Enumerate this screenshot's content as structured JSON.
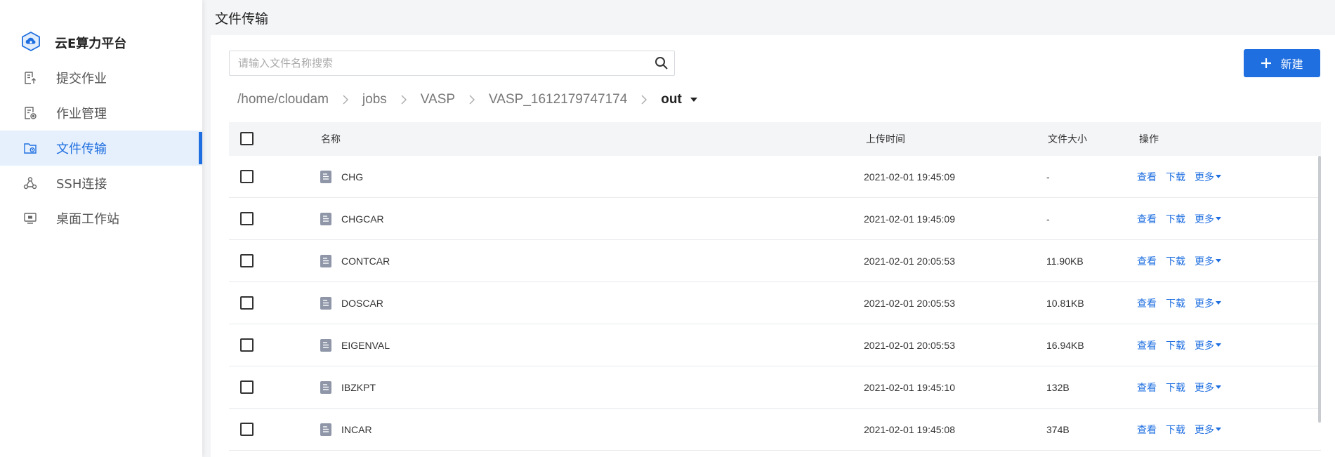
{
  "app": {
    "name": "云E算力平台",
    "page_title": "文件传输"
  },
  "sidebar": {
    "items": [
      {
        "label": "提交作业",
        "icon": "submit-job-icon"
      },
      {
        "label": "作业管理",
        "icon": "job-manage-icon"
      },
      {
        "label": "文件传输",
        "icon": "file-transfer-icon",
        "active": true
      },
      {
        "label": "SSH连接",
        "icon": "ssh-icon"
      },
      {
        "label": "桌面工作站",
        "icon": "desktop-icon"
      }
    ]
  },
  "search": {
    "placeholder": "请输入文件名称搜索",
    "value": ""
  },
  "toolbar": {
    "new_label": "新建"
  },
  "breadcrumb": {
    "items": [
      "/home/cloudam",
      "jobs",
      "VASP",
      "VASP_1612179747174"
    ],
    "current": "out"
  },
  "table": {
    "headers": {
      "name": "名称",
      "time": "上传时间",
      "size": "文件大小",
      "ops": "操作"
    },
    "ops_labels": {
      "view": "查看",
      "download": "下载",
      "more": "更多"
    },
    "rows": [
      {
        "name": "CHG",
        "time": "2021-02-01 19:45:09",
        "size": "-"
      },
      {
        "name": "CHGCAR",
        "time": "2021-02-01 19:45:09",
        "size": "-"
      },
      {
        "name": "CONTCAR",
        "time": "2021-02-01 20:05:53",
        "size": "11.90KB"
      },
      {
        "name": "DOSCAR",
        "time": "2021-02-01 20:05:53",
        "size": "10.81KB"
      },
      {
        "name": "EIGENVAL",
        "time": "2021-02-01 20:05:53",
        "size": "16.94KB"
      },
      {
        "name": "IBZKPT",
        "time": "2021-02-01 19:45:10",
        "size": "132B"
      },
      {
        "name": "INCAR",
        "time": "2021-02-01 19:45:08",
        "size": "374B"
      }
    ]
  },
  "colors": {
    "accent": "#1f6fe0",
    "active_bg": "#e6f0fd",
    "file_icon": "#8e96a8"
  }
}
